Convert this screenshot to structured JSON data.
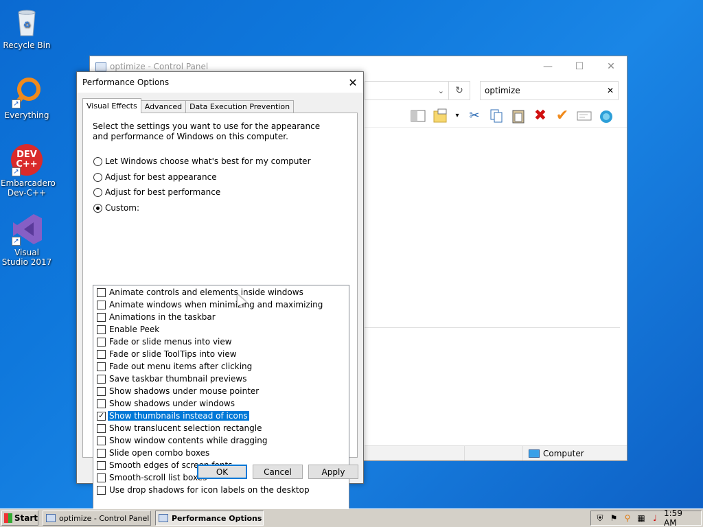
{
  "desktop": {
    "icons": [
      {
        "label": "Recycle Bin"
      },
      {
        "label": "Everything"
      },
      {
        "label": "Embarcadero Dev-C++",
        "art": "DEV C++"
      },
      {
        "label": "Visual Studio 2017"
      }
    ]
  },
  "control_panel": {
    "title": "optimize - Control Panel",
    "search_value": "optimize",
    "status_location": "Computer"
  },
  "dialog": {
    "title": "Performance Options",
    "tabs": [
      {
        "label": "Visual Effects",
        "active": true
      },
      {
        "label": "Advanced",
        "active": false
      },
      {
        "label": "Data Execution Prevention",
        "active": false
      }
    ],
    "intro": "Select the settings you want to use for the appearance and performance of Windows on this computer.",
    "radio_options": [
      {
        "label": "Let Windows choose what's best for my computer",
        "selected": false
      },
      {
        "label": "Adjust for best appearance",
        "selected": false
      },
      {
        "label": "Adjust for best performance",
        "selected": false
      },
      {
        "label": "Custom:",
        "selected": true
      }
    ],
    "effects": [
      {
        "label": "Animate controls and elements inside windows",
        "checked": false
      },
      {
        "label": "Animate windows when minimizing and maximizing",
        "checked": false
      },
      {
        "label": "Animations in the taskbar",
        "checked": false
      },
      {
        "label": "Enable Peek",
        "checked": false
      },
      {
        "label": "Fade or slide menus into view",
        "checked": false
      },
      {
        "label": "Fade or slide ToolTips into view",
        "checked": false
      },
      {
        "label": "Fade out menu items after clicking",
        "checked": false
      },
      {
        "label": "Save taskbar thumbnail previews",
        "checked": false
      },
      {
        "label": "Show shadows under mouse pointer",
        "checked": false
      },
      {
        "label": "Show shadows under windows",
        "checked": false
      },
      {
        "label": "Show thumbnails instead of icons",
        "checked": true,
        "selected": true
      },
      {
        "label": "Show translucent selection rectangle",
        "checked": false
      },
      {
        "label": "Show window contents while dragging",
        "checked": false
      },
      {
        "label": "Slide open combo boxes",
        "checked": false
      },
      {
        "label": "Smooth edges of screen fonts",
        "checked": false
      },
      {
        "label": "Smooth-scroll list boxes",
        "checked": false
      },
      {
        "label": "Use drop shadows for icon labels on the desktop",
        "checked": false
      }
    ],
    "buttons": {
      "ok": "OK",
      "cancel": "Cancel",
      "apply": "Apply"
    }
  },
  "taskbar": {
    "start": "Start",
    "tasks": [
      {
        "label": "optimize - Control Panel",
        "active": false
      },
      {
        "label": "Performance Options",
        "active": true
      }
    ],
    "clock": "1:59 AM"
  },
  "colors": {
    "selection": "#0078d7",
    "desktop": "#0f78dc"
  }
}
